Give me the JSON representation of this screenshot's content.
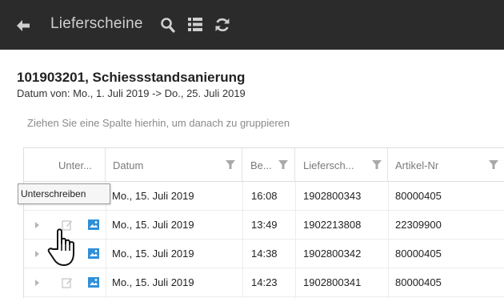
{
  "toolbar": {
    "title": "Lieferscheine",
    "back_icon": "arrow-left-icon",
    "search_icon": "search-icon",
    "list_icon": "list-icon",
    "refresh_icon": "refresh-icon"
  },
  "header": {
    "title": "101903201, Schiessstandsanierung",
    "subtitle": "Datum von: Mo., 1. Juli 2019 -> Do., 25. Juli 2019",
    "group_hint": "Ziehen Sie eine Spalte hierhin, um danach zu gruppieren"
  },
  "grid": {
    "columns": [
      "Unter...",
      "Datum",
      "Be...",
      "Liefersch...",
      "Artikel-Nr"
    ],
    "rows": [
      {
        "datum": "Mo., 15. Juli 2019",
        "zeit": "16:08",
        "lieferschein": "1902800343",
        "artikel": "80000405"
      },
      {
        "datum": "Mo., 15. Juli 2019",
        "zeit": "13:49",
        "lieferschein": "1902213808",
        "artikel": "22309900"
      },
      {
        "datum": "Mo., 15. Juli 2019",
        "zeit": "14:38",
        "lieferschein": "1902800342",
        "artikel": "80000405"
      },
      {
        "datum": "Mo., 15. Juli 2019",
        "zeit": "14:23",
        "lieferschein": "1902800341",
        "artikel": "80000405"
      }
    ]
  },
  "tooltip": {
    "text": "Unterschreiben"
  },
  "colors": {
    "toolbar_bg": "#2b2b2b",
    "toolbar_fg": "#cfcfcf",
    "image_icon_blue": "#2e8fd9"
  }
}
